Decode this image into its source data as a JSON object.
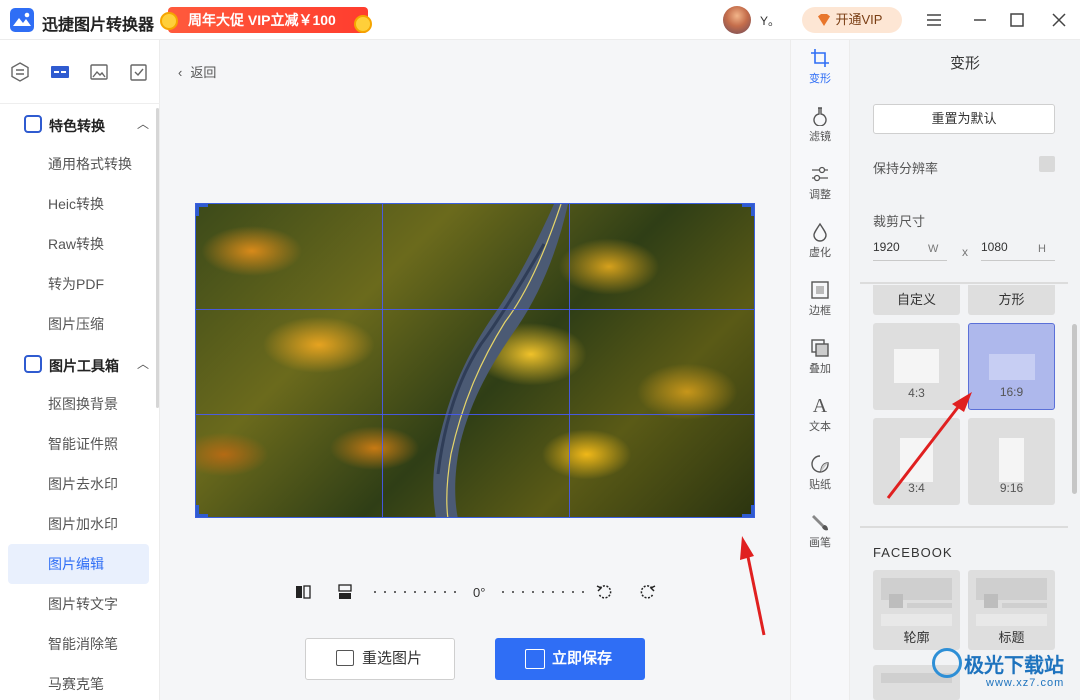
{
  "app": {
    "title": "迅捷图片转换器",
    "promo": "周年大促 VIP立减￥100",
    "user": "Y。",
    "vip_button": "开通VIP",
    "window_controls": [
      "menu-icon",
      "minimize-icon",
      "maximize-icon",
      "close-icon"
    ]
  },
  "sidebar": {
    "tabs": [
      "convert-icon",
      "toolbox-icon",
      "image-icon",
      "checkbox-icon"
    ],
    "groups": [
      {
        "label": "特色转换",
        "items": [
          "通用格式转换",
          "Heic转换",
          "Raw转换",
          "转为PDF",
          "图片压缩"
        ]
      },
      {
        "label": "图片工具箱",
        "items": [
          "抠图换背景",
          "智能证件照",
          "图片去水印",
          "图片加水印",
          "图片编辑",
          "图片转文字",
          "智能消除笔",
          "马赛克笔"
        ]
      }
    ],
    "active_item": "图片编辑"
  },
  "canvas": {
    "back_label": "返回",
    "angle": "0°",
    "reselect_label": "重选图片",
    "save_label": "立即保存"
  },
  "tools": [
    {
      "label": "变形",
      "icon": "crop-icon"
    },
    {
      "label": "滤镜",
      "icon": "filter-icon"
    },
    {
      "label": "调整",
      "icon": "adjust-icon"
    },
    {
      "label": "虚化",
      "icon": "blur-icon"
    },
    {
      "label": "边框",
      "icon": "border-icon"
    },
    {
      "label": "叠加",
      "icon": "overlay-icon"
    },
    {
      "label": "文本",
      "icon": "text-icon"
    },
    {
      "label": "贴纸",
      "icon": "sticker-icon"
    },
    {
      "label": "画笔",
      "icon": "brush-icon"
    }
  ],
  "panel": {
    "title": "变形",
    "reset_label": "重置为默认",
    "keep_resolution": "保持分辨率",
    "crop_size_label": "裁剪尺寸",
    "width": "1920",
    "width_unit": "W",
    "times": "x",
    "height": "1080",
    "height_unit": "H",
    "ratios": [
      "自定义",
      "方形",
      "4:3",
      "16:9",
      "3:4",
      "9:16"
    ],
    "selected_ratio": "16:9",
    "facebook_title": "FACEBOOK",
    "facebook_templates": [
      "轮廓",
      "标题"
    ]
  },
  "watermark": {
    "text": "极光下载站",
    "url": "www.xz7.com"
  },
  "colors": {
    "accent": "#2f6ef5",
    "promo": "#ff4a35",
    "annotation_arrow": "#e02020"
  }
}
